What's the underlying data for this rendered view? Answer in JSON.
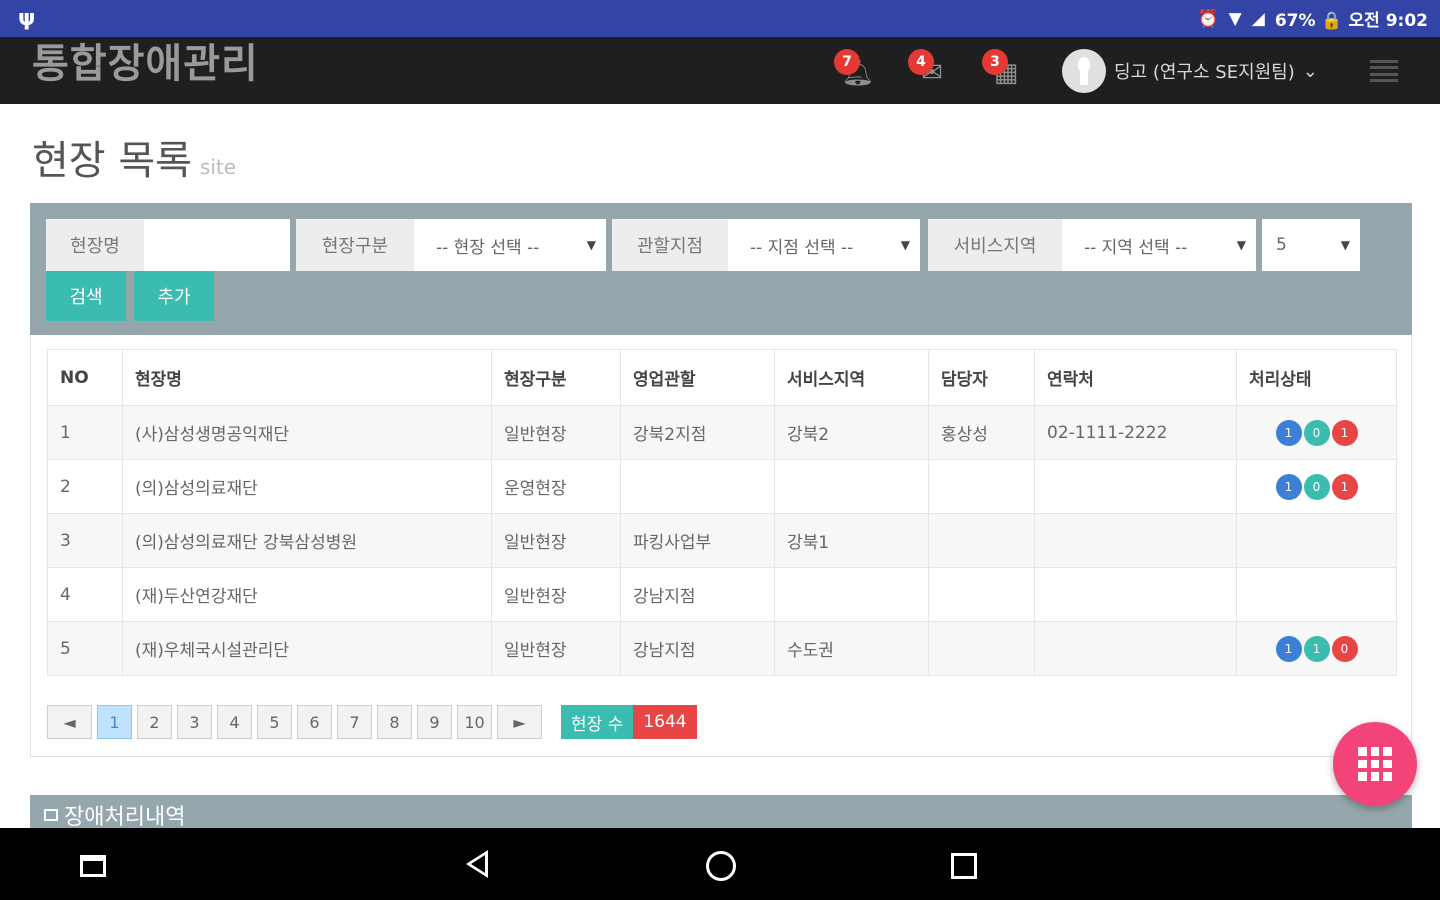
{
  "status_bar": {
    "right_text": "67% 🔒 오전 9:02"
  },
  "app": {
    "title": "통합장애관리",
    "badges": {
      "alarm": "7",
      "mail": "4",
      "calendar": "3"
    },
    "user_name": "딩고 (연구소 SE지원팀)",
    "user_caret": "⌄"
  },
  "page": {
    "title": "현장 목록",
    "subtitle": "site"
  },
  "filters": {
    "site_name_label": "현장명",
    "site_name_value": "",
    "site_type_label": "현장구분",
    "site_type_value": "-- 현장 선택 --",
    "branch_label": "관할지점",
    "branch_value": "-- 지점 선택 --",
    "region_label": "서비스지역",
    "region_value": "-- 지역 선택 --",
    "page_size_value": "5",
    "search_label": "검색",
    "add_label": "추가",
    "dropdown_arrow": "▼"
  },
  "table": {
    "headers": [
      "NO",
      "현장명",
      "현장구분",
      "영업관할",
      "서비스지역",
      "담당자",
      "연락처",
      "처리상태"
    ],
    "rows": [
      {
        "no": "1",
        "name": "(사)삼성생명공익재단",
        "type": "일반현장",
        "sales": "강북2지점",
        "region": "강북2",
        "manager": "홍상성",
        "phone": "02-1111-2222",
        "status": [
          "1",
          "0",
          "1"
        ]
      },
      {
        "no": "2",
        "name": "(의)삼성의료재단",
        "type": "운영현장",
        "sales": "",
        "region": "",
        "manager": "",
        "phone": "",
        "status": [
          "1",
          "0",
          "1"
        ]
      },
      {
        "no": "3",
        "name": "(의)삼성의료재단 강북삼성병원",
        "type": "일반현장",
        "sales": "파킹사업부",
        "region": "강북1",
        "manager": "",
        "phone": "",
        "status": []
      },
      {
        "no": "4",
        "name": "(재)두산연강재단",
        "type": "일반현장",
        "sales": "강남지점",
        "region": "",
        "manager": "",
        "phone": "",
        "status": []
      },
      {
        "no": "5",
        "name": "(재)우체국시설관리단",
        "type": "일반현장",
        "sales": "강남지점",
        "region": "수도권",
        "manager": "",
        "phone": "",
        "status": [
          "1",
          "1",
          "0"
        ]
      }
    ]
  },
  "pagination": {
    "prev": "◄",
    "pages": [
      "1",
      "2",
      "3",
      "4",
      "5",
      "6",
      "7",
      "8",
      "9",
      "10"
    ],
    "current": "1",
    "next": "►",
    "count_label": "현장 수",
    "count_value": "1644"
  },
  "section2": {
    "title": "장애처리내역"
  },
  "colors": {
    "statusbar": "#3344a6",
    "appbar": "#1f1f1f",
    "panel": "#95a7ad",
    "teal": "#3bbcb0",
    "red": "#e84545",
    "blue": "#3b7fd6",
    "fab": "#f24479"
  },
  "icons": {
    "status_left": "usb-icon",
    "alarm": "alarm-clock-icon",
    "wifi": "wifi-icon",
    "signal": "cell-signal-icon",
    "battery": "battery-icon",
    "notifications": "bell-icon",
    "mail": "mail-icon",
    "calendar": "calendar-icon",
    "menu": "hamburger-menu-icon",
    "fab": "apps-grid-icon"
  }
}
